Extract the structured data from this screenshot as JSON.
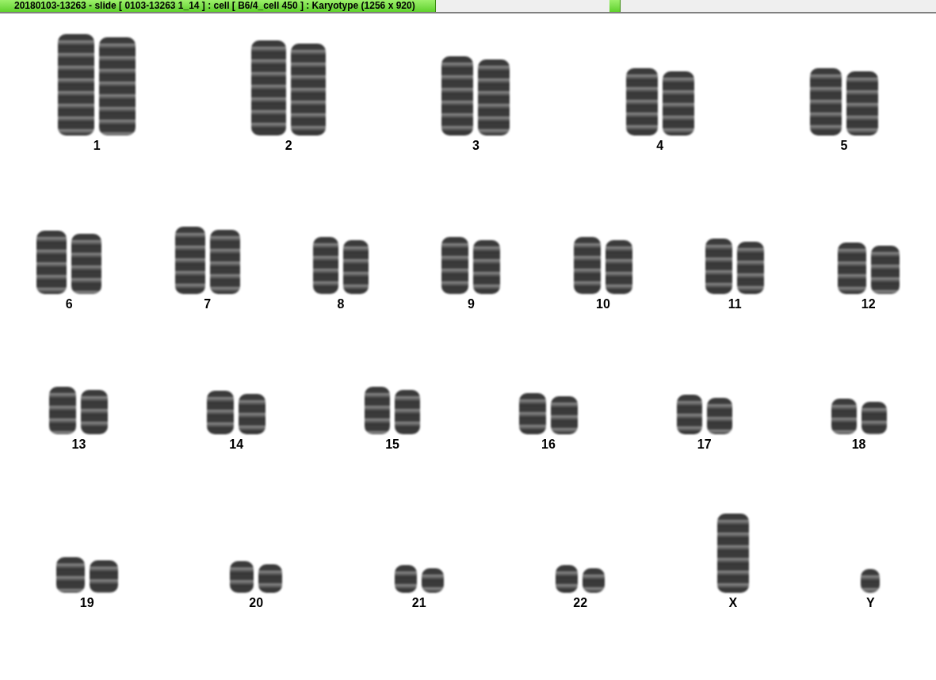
{
  "window": {
    "title": "20180103-13263 - slide [ 0103-13263 1_14 ] : cell [ B6/4_cell 450 ] : Karyotype  (1256 x 920)"
  },
  "karyotype": {
    "rows": [
      {
        "chromosomes": [
          {
            "label": "1",
            "pair": true
          },
          {
            "label": "2",
            "pair": true
          },
          {
            "label": "3",
            "pair": true
          },
          {
            "label": "4",
            "pair": true
          },
          {
            "label": "5",
            "pair": true
          }
        ]
      },
      {
        "chromosomes": [
          {
            "label": "6",
            "pair": true
          },
          {
            "label": "7",
            "pair": true
          },
          {
            "label": "8",
            "pair": true
          },
          {
            "label": "9",
            "pair": true
          },
          {
            "label": "10",
            "pair": true
          },
          {
            "label": "11",
            "pair": true
          },
          {
            "label": "12",
            "pair": true
          }
        ]
      },
      {
        "chromosomes": [
          {
            "label": "13",
            "pair": true
          },
          {
            "label": "14",
            "pair": true
          },
          {
            "label": "15",
            "pair": true
          },
          {
            "label": "16",
            "pair": true
          },
          {
            "label": "17",
            "pair": true
          },
          {
            "label": "18",
            "pair": true
          }
        ]
      },
      {
        "chromosomes": [
          {
            "label": "19",
            "pair": true
          },
          {
            "label": "20",
            "pair": true
          },
          {
            "label": "21",
            "pair": true
          },
          {
            "label": "22",
            "pair": true
          },
          {
            "label": "X",
            "pair": false
          },
          {
            "label": "Y",
            "pair": false
          }
        ]
      }
    ]
  }
}
